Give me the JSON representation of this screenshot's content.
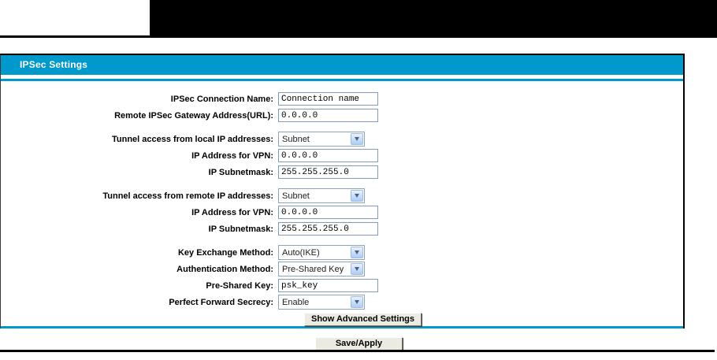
{
  "colors": {
    "accent": "#0099cc",
    "banner": "#000000"
  },
  "header": {
    "title": "IPSec Settings"
  },
  "form": {
    "groups": [
      {
        "rows": [
          {
            "label": "IPSec Connection Name:",
            "type": "text",
            "value": "Connection name"
          },
          {
            "label": "Remote IPSec Gateway Address(URL):",
            "type": "text",
            "value": "0.0.0.0"
          }
        ]
      },
      {
        "rows": [
          {
            "label": "Tunnel access from local IP addresses:",
            "type": "select",
            "value": "Subnet"
          },
          {
            "label": "IP Address for VPN:",
            "type": "text",
            "value": "0.0.0.0"
          },
          {
            "label": "IP Subnetmask:",
            "type": "text",
            "value": "255.255.255.0"
          }
        ]
      },
      {
        "rows": [
          {
            "label": "Tunnel access from remote IP addresses:",
            "type": "select",
            "value": "Subnet"
          },
          {
            "label": "IP Address for VPN:",
            "type": "text",
            "value": "0.0.0.0"
          },
          {
            "label": "IP Subnetmask:",
            "type": "text",
            "value": "255.255.255.0"
          }
        ]
      },
      {
        "rows": [
          {
            "label": "Key Exchange Method:",
            "type": "select",
            "value": "Auto(IKE)"
          },
          {
            "label": "Authentication Method:",
            "type": "select",
            "value": "Pre-Shared Key"
          },
          {
            "label": "Pre-Shared Key:",
            "type": "text",
            "value": "psk_key"
          },
          {
            "label": "Perfect Forward Secrecy:",
            "type": "select",
            "value": "Enable"
          }
        ]
      }
    ],
    "advanced_button_label": "Show Advanced Settings"
  },
  "footer": {
    "save_button_label": "Save/Apply"
  }
}
